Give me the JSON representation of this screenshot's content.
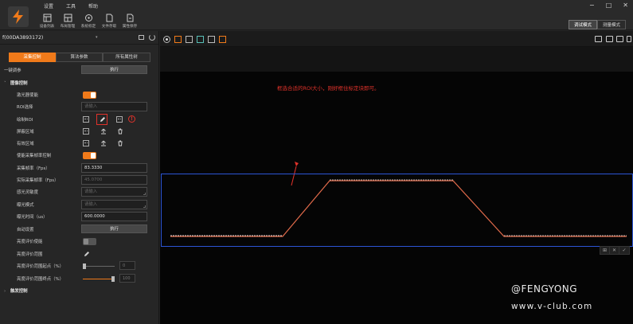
{
  "menu": [
    "设置",
    "工具",
    "帮助"
  ],
  "toolbar": [
    {
      "label": "设备列表",
      "icon": "device-list-icon"
    },
    {
      "label": "布局管理",
      "icon": "layout-icon"
    },
    {
      "label": "系统标定",
      "icon": "calibrate-icon"
    },
    {
      "label": "文件存取",
      "icon": "file-icon"
    },
    {
      "label": "属性保存",
      "icon": "save-props-icon"
    }
  ],
  "window_controls": [
    "−",
    "□",
    "✕"
  ],
  "modes": {
    "debug": "调试模式",
    "measure": "测量模式"
  },
  "device": {
    "title": "f(00DA3893172)"
  },
  "tabs": [
    "采集控制",
    "算法参数",
    "所有属性树"
  ],
  "rows": {
    "one_key_adjust": {
      "label": "一键调参",
      "button": "执行"
    },
    "image_control": {
      "label": "图像控制"
    },
    "laser_enable": {
      "label": "激光器使能"
    },
    "roi_select": {
      "label": "ROI选择",
      "placeholder": "请输入"
    },
    "draw_roi": {
      "label": "绘制ROI"
    },
    "mask_area": {
      "label": "屏蔽区域"
    },
    "valid_area": {
      "label": "有效区域"
    },
    "fps_enable": {
      "label": "使能采集帧率控制"
    },
    "fps": {
      "label": "采集帧率（Fps）",
      "value": "83.3330"
    },
    "actual_fps": {
      "label": "实际采集帧率（Fps）",
      "value": "45.0700"
    },
    "sensitivity": {
      "label": "感光灵敏度",
      "value": "请输入"
    },
    "exposure_mode": {
      "label": "曝光模式",
      "value": "请输入"
    },
    "exposure_time": {
      "label": "曝光时间（us）",
      "value": "600.0000"
    },
    "auto_set": {
      "label": "自动设置",
      "button": "执行"
    },
    "bright_eval_enable": {
      "label": "亮度评价使能"
    },
    "bright_eval_range": {
      "label": "亮度评价范围"
    },
    "bright_range_start": {
      "label": "亮度评价范围起点（%）",
      "value": "0",
      "level": 0.03
    },
    "bright_range_end": {
      "label": "亮度评价范围终点（%）",
      "value": "100",
      "level": 1.0
    },
    "trigger_control": {
      "label": "触发控制"
    }
  },
  "annotation": "框选合适的ROI大小，刚好框住标定块即可。",
  "watermark": {
    "line1": "@FENGYONG",
    "line2": "www.v-club.com"
  },
  "colors": {
    "accent": "#f07a1a",
    "roi_border": "#2b55d6",
    "annotation": "#e0322a"
  }
}
